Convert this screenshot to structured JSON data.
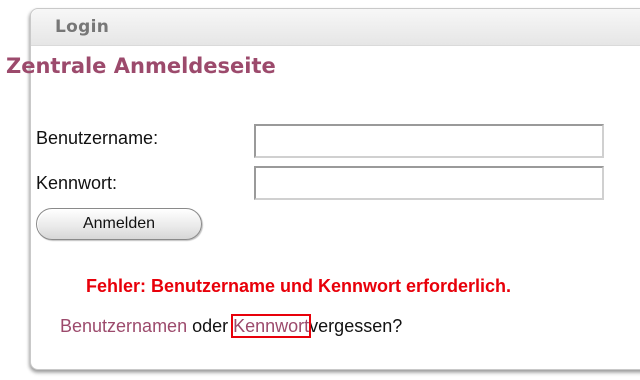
{
  "panel": {
    "title": "Login"
  },
  "page": {
    "heading": "Zentrale Anmeldeseite"
  },
  "form": {
    "username_label": "Benutzername:",
    "username_value": "",
    "password_label": "Kennwort:",
    "password_value": "",
    "submit_label": "Anmelden"
  },
  "error": {
    "message": "Fehler: Benutzername und Kennwort erforderlich."
  },
  "forgot": {
    "username_link": "Benutzernamen",
    "or_text": " oder ",
    "password_link": "Kennwort",
    "suffix_text": "vergessen?"
  },
  "colors": {
    "accent": "#9c4a6c",
    "error": "#e8000a",
    "focus_outline": "#e8000a"
  }
}
